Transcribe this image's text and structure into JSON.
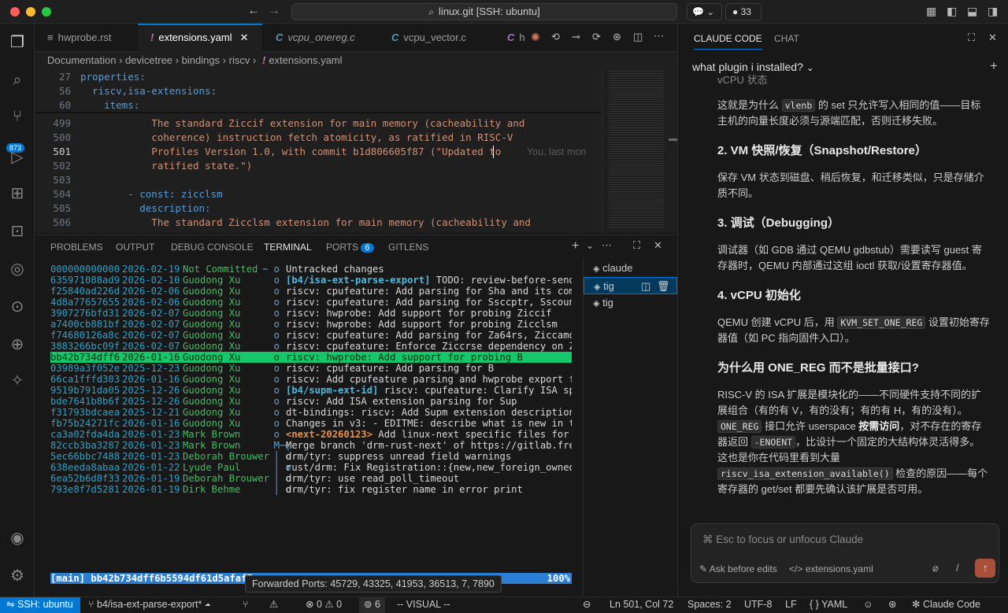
{
  "title_bar": {
    "command_center": "linux.git [SSH: ubuntu]",
    "chat_count": "33"
  },
  "activity": {
    "scm_badge": "873"
  },
  "tabs": [
    {
      "icon": "≡",
      "label": "hwprobe.rst"
    },
    {
      "icon": "!",
      "label": "extensions.yaml"
    },
    {
      "icon": "C",
      "label": "vcpu_onereg.c"
    },
    {
      "icon": "C",
      "label": "vcpu_vector.c"
    },
    {
      "icon": "C",
      "label": "h"
    }
  ],
  "breadcrumb": {
    "parts": [
      "Documentation",
      "devicetree",
      "bindings",
      "riscv"
    ],
    "file_icon": "!",
    "file": "extensions.yaml"
  },
  "editor": {
    "sticky": [
      {
        "num": "27",
        "text": "properties:"
      },
      {
        "num": "56",
        "text": "  riscv,isa-extensions:"
      },
      {
        "num": "60",
        "text": "    items:"
      }
    ],
    "lines": [
      {
        "num": "499",
        "text": "            The standard Ziccif extension for main memory (cacheability and"
      },
      {
        "num": "500",
        "text": "            coherence) instruction fetch atomicity, as ratified in RISC-V"
      },
      {
        "num": "501",
        "text": "            Profiles Version 1.0, with commit b1d806605f87 (\"Updated to"
      },
      {
        "num": "502",
        "text": "            ratified state.\")"
      },
      {
        "num": "503",
        "text": ""
      },
      {
        "num": "504",
        "text": "        - const: zicclsm"
      },
      {
        "num": "505",
        "text": "          description:"
      },
      {
        "num": "506",
        "text": "            The standard Zicclsm extension for main memory (cacheability and"
      }
    ],
    "blame": "You, last mon"
  },
  "panel": {
    "tabs": [
      "PROBLEMS",
      "OUTPUT",
      "DEBUG CONSOLE",
      "TERMINAL",
      "PORTS",
      "GITLENS"
    ],
    "ports_badge": "6"
  },
  "terminal": {
    "rows": [
      {
        "hash": "000000000000",
        "date": "2026-02-19",
        "author": "Not Committed",
        "graph": "~ o",
        "msg": "Untracked changes",
        "cls": "nc"
      },
      {
        "hash": "635971088ad9",
        "date": "2026-02-10",
        "author": "Guodong Xu",
        "graph": "  o",
        "ref": "[b4/isa-ext-parse-export]",
        "msg": " TODO: review-before-send:"
      },
      {
        "hash": "f25840ad226d",
        "date": "2026-02-06",
        "author": "Guodong Xu",
        "graph": "  o",
        "msg": "riscv: cpufeature: Add parsing for Sha and its compr"
      },
      {
        "hash": "4d8a77657655",
        "date": "2026-02-06",
        "author": "Guodong Xu",
        "graph": "  o",
        "msg": "riscv: cpufeature: Add parsing for Ssccptr, Sscounte"
      },
      {
        "hash": "3907276bfd31",
        "date": "2026-02-07",
        "author": "Guodong Xu",
        "graph": "  o",
        "msg": "riscv: hwprobe: Add support for probing Ziccif"
      },
      {
        "hash": "a7400cb881bf",
        "date": "2026-02-07",
        "author": "Guodong Xu",
        "graph": "  o",
        "msg": "riscv: hwprobe: Add support for probing Zicclsm"
      },
      {
        "hash": "f74680126a8c",
        "date": "2026-02-07",
        "author": "Guodong Xu",
        "graph": "  o",
        "msg": "riscv: cpufeature: Add parsing for Za64rs, Ziccamoa,"
      },
      {
        "hash": "3883266bc09f",
        "date": "2026-02-07",
        "author": "Guodong Xu",
        "graph": "  o",
        "msg": "riscv: cpufeature: Enforce Ziccrse dependency on Zal"
      },
      {
        "hash": "bb42b734dff6",
        "date": "2026-01-16",
        "author": "Guodong Xu",
        "graph": "  o",
        "msg": "riscv: hwprobe: Add support for probing B",
        "cls": "sel"
      },
      {
        "hash": "03989a3f052e",
        "date": "2025-12-23",
        "author": "Guodong Xu",
        "graph": "  o",
        "msg": "riscv: cpufeature: Add parsing for B"
      },
      {
        "hash": "66ca1fffd303",
        "date": "2026-01-16",
        "author": "Guodong Xu",
        "graph": "  o",
        "msg": "riscv: Add cpufeature parsing and hwprobe export for"
      },
      {
        "hash": "9519b791da05",
        "date": "2025-12-26",
        "author": "Guodong Xu",
        "graph": "  o",
        "ref": "[b4/supm-ext-id]",
        "msg": " riscv: cpufeature: Clarify ISA spec"
      },
      {
        "hash": "bde7641b8b6f",
        "date": "2025-12-26",
        "author": "Guodong Xu",
        "graph": "  o",
        "msg": "riscv: Add ISA extension parsing for Sup"
      },
      {
        "hash": "f31793bdcaea",
        "date": "2025-12-21",
        "author": "Guodong Xu",
        "graph": "  o",
        "msg": "dt-bindings: riscv: Add Supm extension description"
      },
      {
        "hash": "fb75b24271fc",
        "date": "2026-01-16",
        "author": "Guodong Xu",
        "graph": "  o",
        "msg": "Changes in v3: - EDITME: describe what is new in thi"
      },
      {
        "hash": "ca3a02fda4da",
        "date": "2026-01-23",
        "author": "Mark Brown",
        "graph": "  o",
        "ref": "<next-20260123>",
        "msg": " Add linux-next specific files for 20"
      },
      {
        "hash": "82ccb3ba3287",
        "date": "2026-01-23",
        "author": "Mark Brown",
        "graph": "  M─┐",
        "msg": "Merge branch 'drm-rust-next' of https://gitlab.fre"
      },
      {
        "hash": "5ec66bbc7488",
        "date": "2026-01-23",
        "author": "Deborah Brouwer",
        "graph": "  │ o",
        "msg": "drm/tyr: suppress unread field warnings"
      },
      {
        "hash": "638eeda8abaa",
        "date": "2026-01-22",
        "author": "Lyude Paul",
        "graph": "  │ o",
        "msg": "rust/drm: Fix Registration::{new,new_foreign_owned"
      },
      {
        "hash": "6ea52b6d8f33",
        "date": "2026-01-19",
        "author": "Deborah Brouwer",
        "graph": "  │ o",
        "msg": "drm/tyr: use read_poll_timeout"
      },
      {
        "hash": "793e8f7d5281",
        "date": "2026-01-19",
        "author": "Dirk Behme",
        "graph": "  │ o",
        "msg": "drm/tyr: fix register name in error print"
      }
    ],
    "status_line": "[main] bb42b734dff6b5594df61d5afaf7",
    "percent": "100%",
    "tooltip": "Forwarded Ports: 45729, 43325, 41953, 36513, 7, 7890",
    "instances": [
      "claude",
      "tig",
      "tig"
    ]
  },
  "right": {
    "tabs": [
      "CLAUDE CODE",
      "CHAT"
    ],
    "session": "what plugin i installed?",
    "top_fragment": "vCPU 状态",
    "p1_a": "这就是为什么 ",
    "p1_code": "vlenb",
    "p1_b": " 的 set 只允许写入相同的值——目标主机的向量长度必须与源端匹配，否则迁移失败。",
    "h2": "2. VM 快照/恢复（Snapshot/Restore）",
    "p2": "保存 VM 状态到磁盘、稍后恢复，和迁移类似，只是存储介质不同。",
    "h3": "3. 调试（Debugging）",
    "p3": "调试器（如 GDB 通过 QEMU gdbstub）需要读写 guest 寄存器时，QEMU 内部通过这组 ioctl 获取/设置寄存器值。",
    "h4": "4. vCPU 初始化",
    "p4_a": "QEMU 创建 vCPU 后，用 ",
    "p4_code": "KVM_SET_ONE_REG",
    "p4_b": " 设置初始寄存器值（如 PC 指向固件入口）。",
    "h5": "为什么用 ONE_REG 而不是批量接口?",
    "p5_1": "RISC-V 的 ISA 扩展是模块化的——不同硬件支持不同的扩展组合（有的有 V，有的没有；有的有 H，有的没有）。",
    "p5_code1": "ONE_REG",
    "p5_2": " 接口允许 userspace ",
    "p5_bold": "按需访问",
    "p5_3": "，对不存在的寄存器返回 ",
    "p5_code2": "-ENOENT",
    "p5_4": "，比设计一个固定的大结构体灵活得多。这也是你在代码里看到大量 ",
    "p5_code3": "riscv_isa_extension_available()",
    "p5_5": " 检查的原因——每个寄存器的 get/set 都要先确认该扩展是否可用。",
    "input_placeholder": "⌘ Esc to focus or unfocus Claude",
    "ask_label": "Ask before edits",
    "file_label": "extensions.yaml"
  },
  "status": {
    "remote": "SSH: ubuntu",
    "branch": "b4/isa-ext-parse-export*",
    "errors": "0",
    "warnings": "0",
    "ports": "6",
    "mode": "-- VISUAL --",
    "position": "Ln 501, Col 72",
    "spaces": "Spaces: 2",
    "encoding": "UTF-8",
    "eol": "LF",
    "language": "YAML",
    "claude": "Claude Code"
  }
}
